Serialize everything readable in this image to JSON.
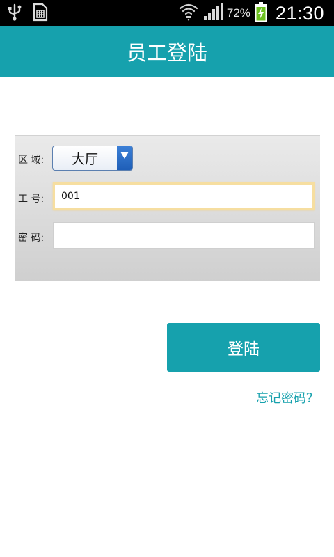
{
  "status_bar": {
    "icons": [
      "usb-icon",
      "sd-card-icon",
      "wifi-icon",
      "signal-icon",
      "battery-charging-icon"
    ],
    "battery_percent": "72%",
    "time": "21:30"
  },
  "header": {
    "title": "员工登陆"
  },
  "form": {
    "region": {
      "label": "区 域:",
      "selected": "大厅",
      "arrow_color": "#1f5fb8"
    },
    "employee_id": {
      "label": "工 号:",
      "value": "001"
    },
    "password": {
      "label": "密 码:",
      "value": ""
    }
  },
  "actions": {
    "login_label": "登陆",
    "forgot_label": "忘记密码？"
  },
  "colors": {
    "accent": "#16a1ad",
    "status_bar": "#000000",
    "focus_ring": "#f6dea0"
  }
}
